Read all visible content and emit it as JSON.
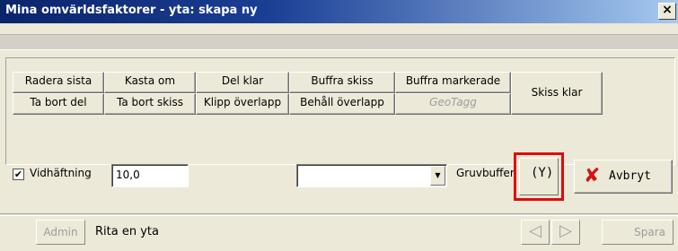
{
  "window": {
    "title": "Mina omvärldsfaktorer - yta: skapa ny",
    "close_glyph": "×"
  },
  "toolbar": {
    "row1": [
      "Radera sista",
      "Kasta om",
      "Del klar",
      "Buffra skiss",
      "Buffra markerade"
    ],
    "row2": [
      "Ta bort del",
      "Ta bort skiss",
      "Klipp överlapp",
      "Behåll överlapp",
      "GeoTagg"
    ],
    "skiss_klar": "Skiss klar"
  },
  "options": {
    "vidhaftning_checked": true,
    "vidhaftning_check_glyph": "✔",
    "vidhaftning_label": "Vidhäftning",
    "vidhaftning_value": "10,0",
    "combo_value": "",
    "combo_arrow_glyph": "▼",
    "gruvbuffer_label": "Gruvbuffer",
    "gruvbuffer_icon": "(Y)",
    "avbryt_icon": "✘",
    "avbryt_label": "Avbryt"
  },
  "statusbar": {
    "admin_label": "Admin",
    "status_text": "Rita en yta",
    "prev_glyph": "◁",
    "next_glyph": "▷",
    "spara_label": "Spara"
  },
  "colors": {
    "title_bg": "#0a246a",
    "highlight": "#e20a0a",
    "cancel_icon": "#d41414"
  }
}
